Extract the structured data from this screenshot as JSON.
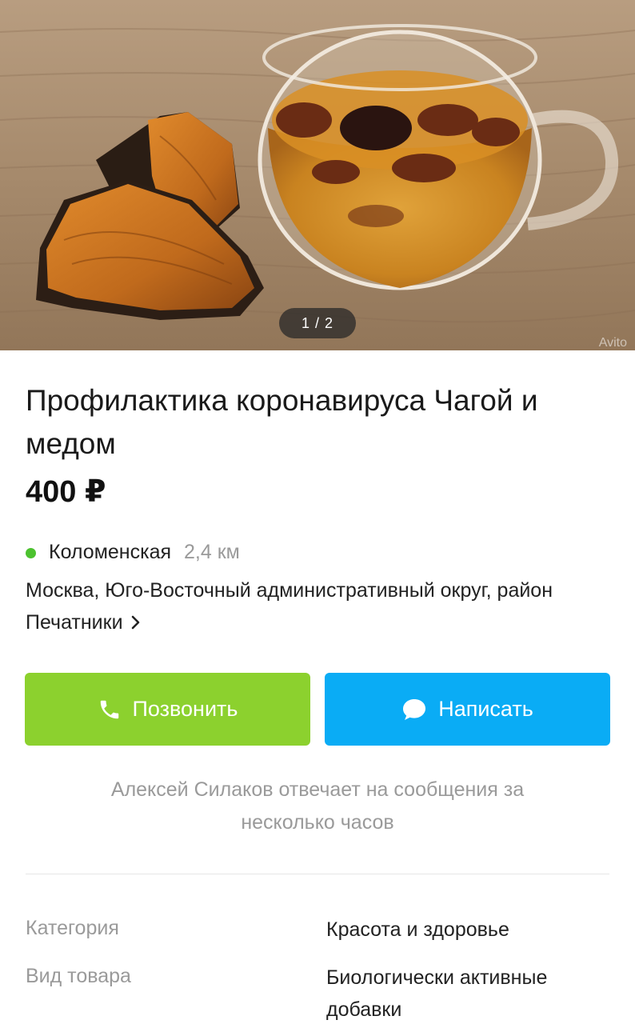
{
  "gallery": {
    "counter": "1 / 2",
    "watermark": "Avito"
  },
  "listing": {
    "title": "Профилактика коронавируса Чагой и медом",
    "price": "400 ₽"
  },
  "location": {
    "metro_station": "Коломенская",
    "metro_distance": "2,4 км",
    "metro_color": "#4cc22f",
    "address": "Москва, Юго-Восточный административный округ, район Печатники"
  },
  "actions": {
    "call_label": "Позвонить",
    "call_color": "#8cd12e",
    "call_icon": "phone-icon",
    "message_label": "Написать",
    "message_color": "#0aacf5",
    "message_icon": "chat-bubble-icon"
  },
  "seller": {
    "reply_note": "Алексей Силаков отвечает на сообщения за несколько часов"
  },
  "params": [
    {
      "label": "Категория",
      "value": "Красота и здоровье"
    },
    {
      "label": "Вид товара",
      "value": "Биологически активные добавки"
    }
  ]
}
